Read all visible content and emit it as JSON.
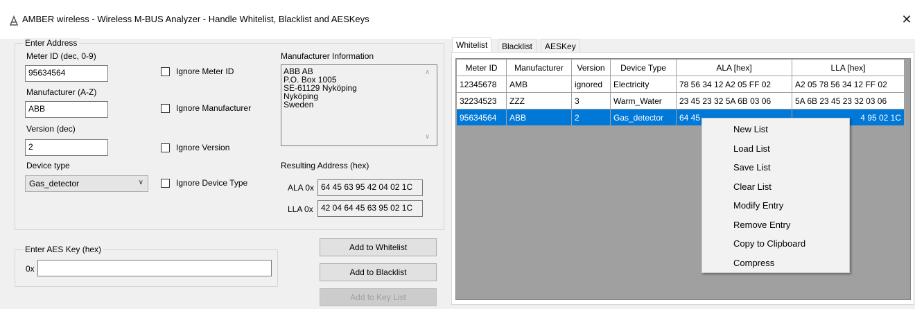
{
  "window": {
    "title": "AMBER wireless - Wireless M-BUS Analyzer - Handle Whitelist, Blacklist and AESKeys",
    "icon": "amber-app-icon",
    "close_glyph": "✕"
  },
  "enter_address": {
    "legend": "Enter Address",
    "meter_id_label": "Meter ID (dec, 0-9)",
    "meter_id_value": "95634564",
    "manufacturer_label": "Manufacturer (A-Z)",
    "manufacturer_value": "ABB",
    "version_label": "Version (dec)",
    "version_value": "2",
    "device_type_label": "Device type",
    "device_type_value": "Gas_detector",
    "ignore_meter_id": "Ignore Meter ID",
    "ignore_manufacturer": "Ignore Manufacturer",
    "ignore_version": "Ignore Version",
    "ignore_device_type": "Ignore Device Type",
    "manufacturer_info_label": "Manufacturer Information",
    "manufacturer_info_text": "ABB AB\nP.O. Box 1005\nSE-61129 Nyköping\nNyköping\nSweden",
    "resulting_address_label": "Resulting Address (hex)",
    "ala_label": "ALA 0x",
    "ala_value": "64 45 63 95 42 04 02 1C",
    "lla_label": "LLA 0x",
    "lla_value": "42 04 64 45 63 95 02 1C"
  },
  "aes": {
    "legend": "Enter AES Key (hex)",
    "prefix": "0x",
    "value": ""
  },
  "buttons": {
    "add_whitelist": "Add to Whitelist",
    "add_blacklist": "Add to Blacklist",
    "add_keylist": "Add to Key List"
  },
  "tabs": [
    {
      "label": "Whitelist",
      "active": true
    },
    {
      "label": "Blacklist",
      "active": false
    },
    {
      "label": "AESKey",
      "active": false
    }
  ],
  "table": {
    "headers": [
      "Meter ID",
      "Manufacturer",
      "Version",
      "Device Type",
      "ALA [hex]",
      "LLA [hex]"
    ],
    "rows": [
      [
        "12345678",
        "AMB",
        "ignored",
        "Electricity",
        "78 56 34 12 A2 05 FF 02",
        "A2 05 78 56 34 12 FF 02"
      ],
      [
        "32234523",
        "ZZZ",
        "3",
        "Warm_Water",
        "23 45 23 32 5A 6B 03 06",
        "5A 6B 23 45 23 32 03 06"
      ],
      [
        "95634564",
        "ABB",
        "2",
        "Gas_detector",
        "64 45",
        "4 95 02 1C"
      ]
    ],
    "selected_row": 2
  },
  "context_menu": {
    "items": [
      "New List",
      "Load List",
      "Save List",
      "Clear List",
      "Modify Entry",
      "Remove Entry",
      "Copy to Clipboard",
      "Compress"
    ]
  },
  "colors": {
    "selection": "#0078d7",
    "grid_background": "#a0a0a0"
  }
}
